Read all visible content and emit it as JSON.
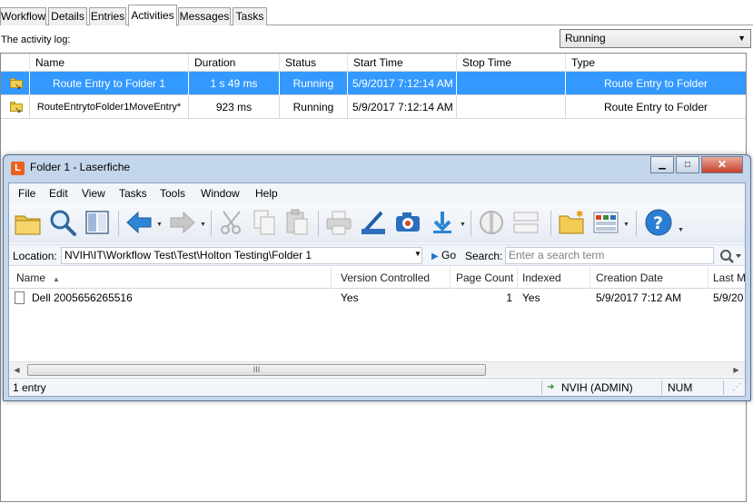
{
  "tabs": [
    {
      "label": "Workflow",
      "active": false
    },
    {
      "label": "Details",
      "active": false
    },
    {
      "label": "Entries",
      "active": false
    },
    {
      "label": "Activities",
      "active": true
    },
    {
      "label": "Messages",
      "active": false
    },
    {
      "label": "Tasks",
      "active": false
    }
  ],
  "activity_log_label": "The activity log:",
  "status_filter": {
    "selected": "Running"
  },
  "activity_table": {
    "columns": [
      "Name",
      "Duration",
      "Status",
      "Start Time",
      "Stop Time",
      "Type"
    ],
    "rows": [
      {
        "name": "Route Entry to Folder 1",
        "duration": "1 s 49 ms",
        "status": "Running",
        "start": "5/9/2017 7:12:14 AM",
        "stop": "",
        "type": "Route Entry to Folder",
        "selected": true
      },
      {
        "name": "RouteEntrytoFolder1MoveEntry*",
        "duration": "923 ms",
        "status": "Running",
        "start": "5/9/2017 7:12:14 AM",
        "stop": "",
        "type": "Route Entry to Folder",
        "selected": false
      }
    ]
  },
  "lf_window": {
    "app_icon_letter": "L",
    "title": "Folder 1 - Laserfiche",
    "menu": [
      "File",
      "Edit",
      "View",
      "Tasks",
      "Tools",
      "Window",
      "Help"
    ],
    "toolbar_icons": [
      "open-folder-icon",
      "search-icon",
      "browser-pane-icon",
      "back-arrow-icon",
      "forward-arrow-icon",
      "cut-icon",
      "copy-icon",
      "paste-icon",
      "print-icon",
      "scan-icon",
      "snapshot-icon",
      "import-icon",
      "metadata-icon",
      "view-toggle-icon",
      "new-folder-icon",
      "columns-icon",
      "help-icon"
    ],
    "location_label": "Location:",
    "location_path": "NVIH\\IT\\Workflow Test\\Test\\Holton Testing\\Folder 1",
    "go_label": "Go",
    "search_label": "Search:",
    "search_placeholder": "Enter a search term",
    "list_columns": [
      "Name",
      "Version Controlled",
      "Page Count",
      "Indexed",
      "Creation Date",
      "Last M"
    ],
    "list_rows": [
      {
        "name": "Dell 2005656265516",
        "version_controlled": "Yes",
        "page_count": "1",
        "indexed": "Yes",
        "creation_date": "5/9/2017 7:12 AM",
        "last_modified": "5/9/20"
      }
    ],
    "scroll_grip": "III",
    "status": {
      "entries": "1 entry",
      "user": "NVIH (ADMIN)",
      "num": "NUM"
    }
  },
  "colors": {
    "selection": "#3399ff",
    "accent_blue": "#2373c9",
    "title_frame": "#c4d6ec"
  }
}
